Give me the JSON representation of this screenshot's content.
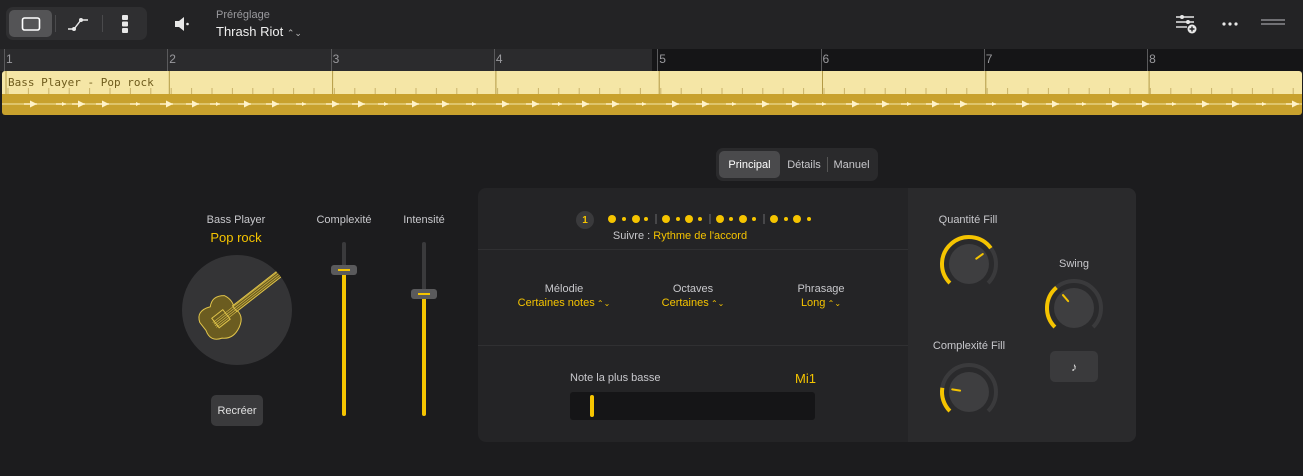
{
  "toolbar": {
    "preset_caption": "Préréglage",
    "preset_name": "Thrash Riot"
  },
  "ruler": {
    "bars": [
      "1",
      "2",
      "3",
      "4",
      "5",
      "6",
      "7",
      "8"
    ]
  },
  "region": {
    "name": "Bass Player - Pop rock"
  },
  "tabs": [
    {
      "label": "Principal",
      "selected": true
    },
    {
      "label": "Détails",
      "selected": false
    },
    {
      "label": "Manuel",
      "selected": false
    }
  ],
  "player": {
    "name": "Bass Player",
    "style": "Pop rock",
    "regenerate_label": "Recréer"
  },
  "sliders": {
    "complexity": {
      "label": "Complexité",
      "value": 0.84
    },
    "intensity": {
      "label": "Intensité",
      "value": 0.7
    }
  },
  "pattern": {
    "beat_number": "1",
    "follow_label": "Suivre :",
    "follow_value": "Rythme de l'accord"
  },
  "options": {
    "melody": {
      "label": "Mélodie",
      "value": "Certaines notes"
    },
    "octaves": {
      "label": "Octaves",
      "value": "Certaines"
    },
    "phrasing": {
      "label": "Phrasage",
      "value": "Long"
    }
  },
  "lowest_note": {
    "label": "Note la plus basse",
    "value": "Mi1",
    "position": 0.09
  },
  "knobs": {
    "fill_amount": {
      "label": "Quantité Fill",
      "value": 0.7
    },
    "fill_complexity": {
      "label": "Complexité Fill",
      "value": 0.2
    },
    "swing": {
      "label": "Swing",
      "value": 0.35
    }
  },
  "colors": {
    "accent": "#f5c400",
    "background": "#1c1c1e",
    "region_light": "#f5e6a6",
    "region_dark": "#c8a12d"
  }
}
